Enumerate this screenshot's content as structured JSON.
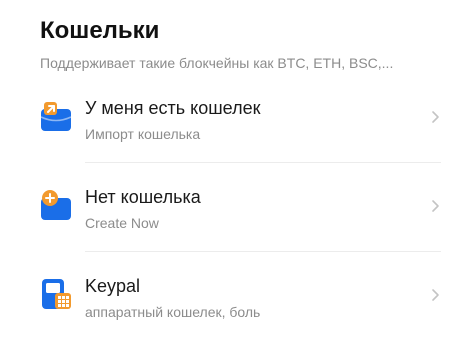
{
  "header": {
    "title": "Кошельки",
    "subtitle": "Поддерживает такие блокчейны как BTC, ETH, BSC,..."
  },
  "colors": {
    "accent_blue": "#1a6ee8",
    "accent_orange": "#f29a2e"
  },
  "items": [
    {
      "title": "У меня есть кошелек",
      "subtitle": "Импорт кошелька",
      "icon": "import-wallet-icon"
    },
    {
      "title": "Нет кошелька",
      "subtitle": "Create Now",
      "icon": "create-wallet-icon"
    },
    {
      "title": "Keypal",
      "subtitle": "аппаратный кошелек, боль",
      "icon": "hardware-wallet-icon"
    }
  ]
}
